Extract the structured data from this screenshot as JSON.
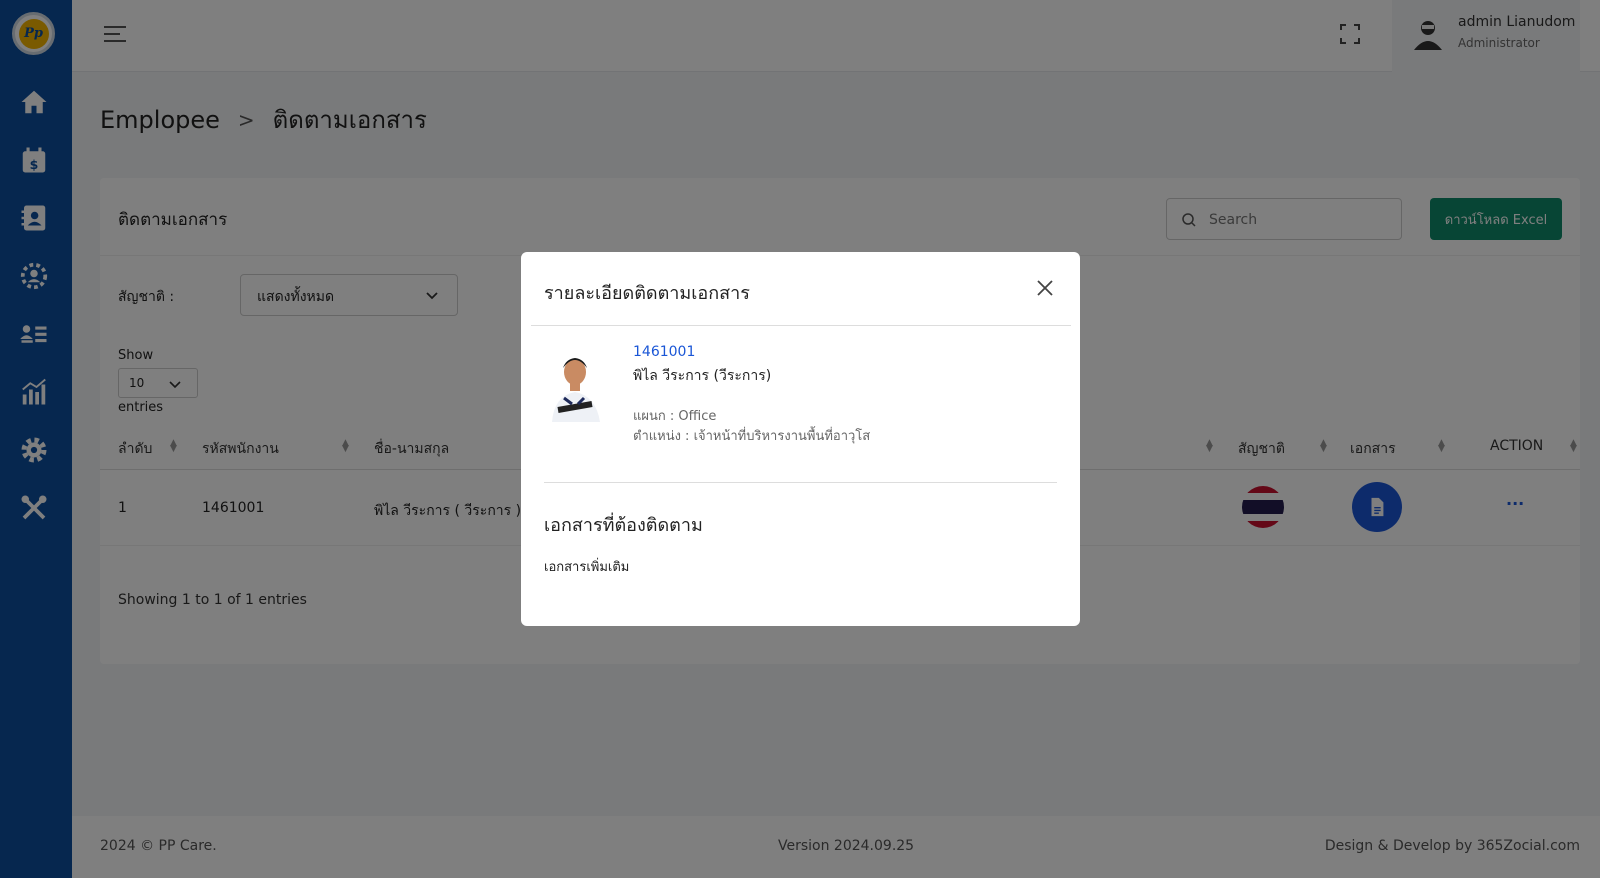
{
  "sidebar": {
    "logo_text": "Pp",
    "icons": [
      "home-icon",
      "calendar-money-icon",
      "contact-card-icon",
      "team-gear-icon",
      "user-list-icon",
      "chart-icon",
      "settings-icon",
      "tools-icon"
    ]
  },
  "header": {
    "user_name": "admin Lianudom",
    "user_role": "Administrator"
  },
  "breadcrumb": {
    "parent": "Emplopee",
    "separator": ">",
    "current": "ติดตามเอกสาร"
  },
  "card": {
    "title": "ติดตามเอกสาร",
    "search_placeholder": "Search",
    "excel_button": "ดาวน์โหลด Excel",
    "filter_label": "สัญชาติ :",
    "filter_value": "แสดงทั้งหมด",
    "length_show": "Show",
    "length_value": "10",
    "length_entries": "entries",
    "columns": {
      "index": "ลำดับ",
      "emp_code": "รหัสพนักงาน",
      "name": "ชื่อ-นามสกุล",
      "nationality": "สัญชาติ",
      "documents": "เอกสาร",
      "action": "ACTION"
    },
    "rows": [
      {
        "index": "1",
        "emp_code": "1461001",
        "name": "พิไล วีระการ ( วีระการ )",
        "action": "···"
      }
    ],
    "info": "Showing 1 to 1 of 1 entries"
  },
  "footer": {
    "copyright": "2024 © PP Care.",
    "version": "Version 2024.09.25",
    "credit": "Design & Develop by 365Zocial.com"
  },
  "modal": {
    "title": "รายละเอียดติดตามเอกสาร",
    "employee": {
      "id": "1461001",
      "name": "พิไล วีระการ (วีระการ)",
      "department": "แผนก : Office",
      "position": "ตำแหน่ง : เจ้าหน้าที่บริหารงานพื้นที่อาวุโส"
    },
    "docs_heading": "เอกสารที่ต้องติดตาม",
    "docs_item": "เอกสารเพิ่มเติม"
  },
  "colors": {
    "sidebar": "#0d4f9e",
    "excel_button": "#0f8a6a",
    "link_blue": "#1a56d6"
  }
}
